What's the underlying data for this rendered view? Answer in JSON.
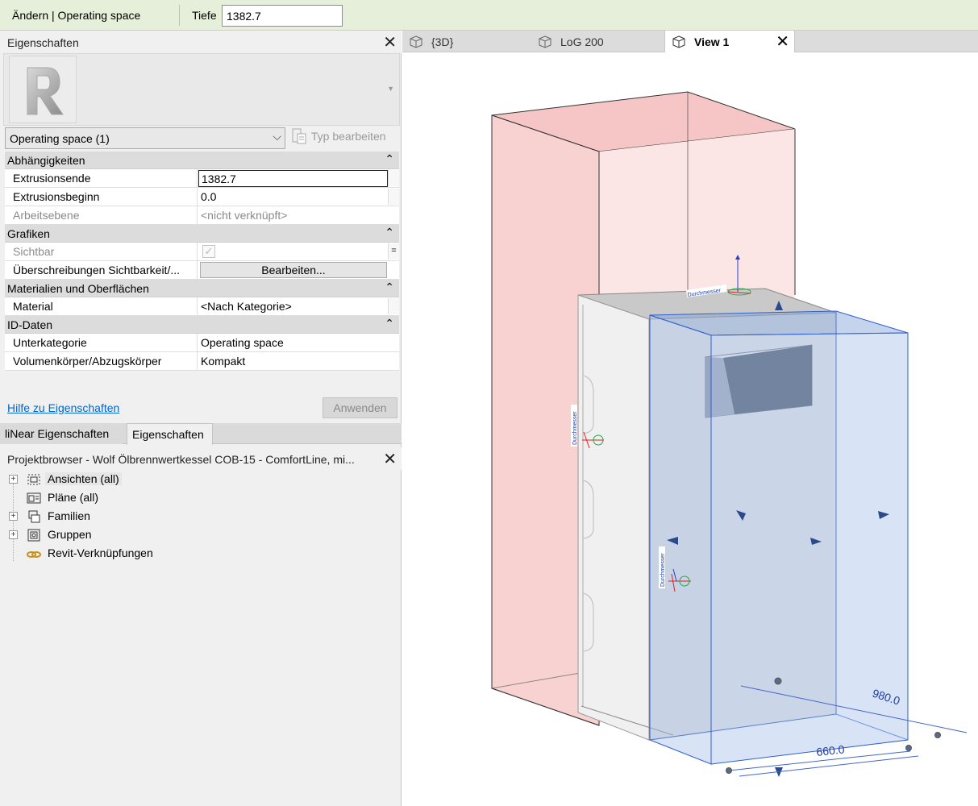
{
  "options_bar": {
    "mode": "Ändern | Operating space",
    "depth_label": "Tiefe",
    "depth_value": "1382.7"
  },
  "properties": {
    "title": "Eigenschaften",
    "type_selector": "Operating space (1)",
    "edit_type": "Typ bearbeiten",
    "categories": [
      {
        "name": "Abhängigkeiten",
        "rows": [
          {
            "name": "Extrusionsende",
            "value": "1382.7"
          },
          {
            "name": "Extrusionsbeginn",
            "value": "0.0"
          },
          {
            "name": "Arbeitsebene",
            "value": "<nicht verknüpft>"
          }
        ]
      },
      {
        "name": "Grafiken",
        "rows": [
          {
            "name": "Sichtbar",
            "value": ""
          },
          {
            "name": "Überschreibungen Sichtbarkeit/...",
            "value": "Bearbeiten..."
          }
        ]
      },
      {
        "name": "Materialien und Oberflächen",
        "rows": [
          {
            "name": "Material",
            "value": "<Nach Kategorie>"
          }
        ]
      },
      {
        "name": "ID-Daten",
        "rows": [
          {
            "name": "Unterkategorie",
            "value": "Operating space"
          },
          {
            "name": "Volumenkörper/Abzugskörper",
            "value": "Kompakt"
          }
        ]
      }
    ],
    "help_link": "Hilfe zu Eigenschaften",
    "apply": "Anwenden"
  },
  "panel_tabs": [
    "liNear Eigenschaften",
    "Eigenschaften"
  ],
  "project_browser": {
    "title": "Projektbrowser - Wolf Ölbrennwertkessel COB-15 - ComfortLine, mi...",
    "items": [
      {
        "label": "Ansichten (all)",
        "icon": "views-icon"
      },
      {
        "label": "Pläne (all)",
        "icon": "sheets-icon"
      },
      {
        "label": "Familien",
        "icon": "families-icon"
      },
      {
        "label": "Gruppen",
        "icon": "groups-icon"
      },
      {
        "label": "Revit-Verknüpfungen",
        "icon": "link-icon"
      }
    ]
  },
  "view_tabs": [
    "{3D}",
    "LoG 200",
    "View 1"
  ],
  "viewport": {
    "dimensions": [
      "980.0",
      "660.0"
    ],
    "labels": [
      "Durchmesser",
      "Durchmesser",
      "Durchmesser"
    ]
  },
  "colors": {
    "options_bar": "#e6efd9",
    "panel": "#f0f0f0",
    "link": "#0066cc",
    "pink_box": "#f4b9b8",
    "blue_box": "#a9c2ea",
    "blue_edge": "#2f5fd0"
  }
}
